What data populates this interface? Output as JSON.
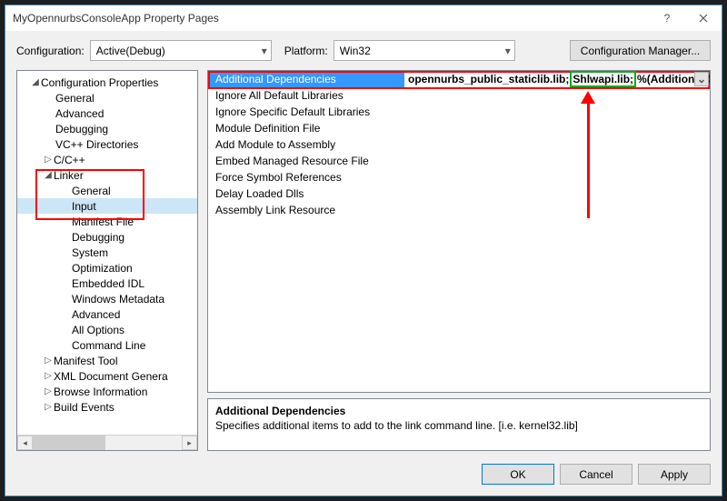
{
  "titlebar": {
    "title": "MyOpennurbsConsoleApp Property Pages"
  },
  "toprow": {
    "config_label": "Configuration:",
    "config_value": "Active(Debug)",
    "platform_label": "Platform:",
    "platform_value": "Win32",
    "config_mgr_label": "Configuration Manager..."
  },
  "tree": {
    "root": "Configuration Properties",
    "items_l2_top": [
      "General",
      "Advanced",
      "Debugging",
      "VC++ Directories"
    ],
    "cxx": "C/C++",
    "linker": "Linker",
    "linker_children": [
      "General",
      "Input",
      "Manifest File",
      "Debugging",
      "System",
      "Optimization",
      "Embedded IDL",
      "Windows Metadata",
      "Advanced",
      "All Options",
      "Command Line"
    ],
    "selected_linker_child": "Input",
    "items_l2_bottom": [
      "Manifest Tool",
      "XML Document Genera",
      "Browse Information",
      "Build Events"
    ]
  },
  "grid": {
    "rows": [
      {
        "label": "Additional Dependencies",
        "value_prefix": "opennurbs_public_staticlib.lib;",
        "value_green": "Shlwapi.lib;",
        "value_suffix": "%(AdditionalDe"
      },
      {
        "label": "Ignore All Default Libraries",
        "value": ""
      },
      {
        "label": "Ignore Specific Default Libraries",
        "value": ""
      },
      {
        "label": "Module Definition File",
        "value": ""
      },
      {
        "label": "Add Module to Assembly",
        "value": ""
      },
      {
        "label": "Embed Managed Resource File",
        "value": ""
      },
      {
        "label": "Force Symbol References",
        "value": ""
      },
      {
        "label": "Delay Loaded Dlls",
        "value": ""
      },
      {
        "label": "Assembly Link Resource",
        "value": ""
      }
    ]
  },
  "desc": {
    "title": "Additional Dependencies",
    "body": "Specifies additional items to add to the link command line. [i.e. kernel32.lib]"
  },
  "buttons": {
    "ok": "OK",
    "cancel": "Cancel",
    "apply": "Apply"
  }
}
